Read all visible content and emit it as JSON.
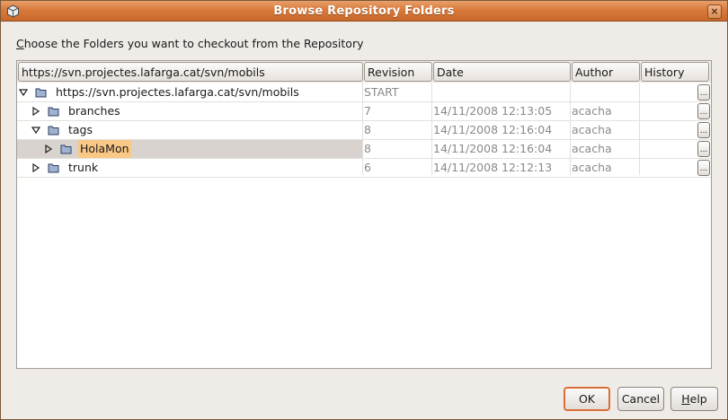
{
  "window": {
    "title": "Browse Repository Folders",
    "close_glyph": "×"
  },
  "prompt": {
    "mnemonic": "C",
    "rest": "hoose the Folders you want to checkout from the Repository"
  },
  "table": {
    "headers": {
      "name": "https://svn.projectes.lafarga.cat/svn/mobils",
      "revision": "Revision",
      "date": "Date",
      "author": "Author",
      "history": "History"
    },
    "rows": [
      {
        "label": "https://svn.projectes.lafarga.cat/svn/mobils",
        "expanded": true,
        "revision": "START",
        "date": "",
        "author": "",
        "history": "..."
      },
      {
        "label": "branches",
        "expanded": false,
        "revision": "7",
        "date": "14/11/2008 12:13:05",
        "author": "acacha",
        "history": "..."
      },
      {
        "label": "tags",
        "expanded": true,
        "revision": "8",
        "date": "14/11/2008 12:16:04",
        "author": "acacha",
        "history": "..."
      },
      {
        "label": "HolaMon",
        "expanded": false,
        "revision": "8",
        "date": "14/11/2008 12:16:04",
        "author": "acacha",
        "history": "...",
        "selected": true
      },
      {
        "label": "trunk",
        "expanded": false,
        "revision": "6",
        "date": "14/11/2008 12:12:13",
        "author": "acacha",
        "history": "..."
      }
    ]
  },
  "buttons": {
    "ok": "OK",
    "cancel": "Cancel",
    "help_mnemonic": "H",
    "help_rest": "elp"
  },
  "colors": {
    "titlebar": "#d97a3c",
    "selection_highlight": "#f9c886",
    "default_button_border": "#d96f36"
  },
  "icons": {
    "app": "app-cube-icon",
    "close": "close-icon",
    "expanded": "triangle-down-icon",
    "collapsed": "triangle-right-icon",
    "folder": "folder-icon"
  }
}
